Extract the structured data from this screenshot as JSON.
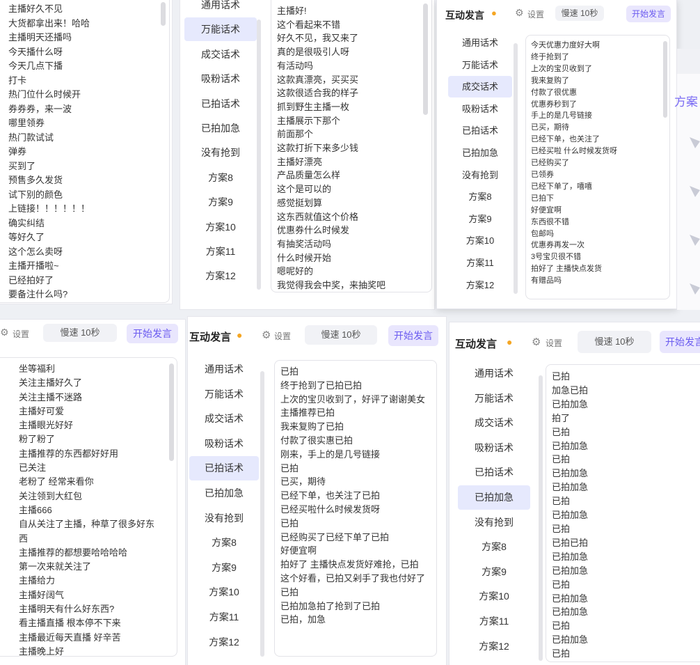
{
  "header": {
    "title": "互动发言",
    "settings_label": "设置",
    "speed_label": "慢速 10秒",
    "start_label": "开始发言"
  },
  "categories": [
    "通用话术",
    "万能话术",
    "成交话术",
    "吸粉话术",
    "已拍话术",
    "已拍加急",
    "没有抢到",
    "方案8",
    "方案9",
    "方案10",
    "方案11",
    "方案12"
  ],
  "panel_a_lines": [
    "主播好久不见",
    "大货都拿出来！哈哈",
    "主播明天还播吗",
    "今天播什么呀",
    "今天几点下播",
    "打卡",
    "热门位什么时候开",
    "券券券，来一波",
    "哪里领券",
    "热门款试试",
    "弹券",
    "买到了",
    "预售多久发货",
    "试下别的颜色",
    "上链接！！！！！！",
    "确实纠结",
    "等好久了",
    "这个怎么卖呀",
    "主播开播啦~",
    "已经拍好了",
    "要备注什么吗?"
  ],
  "panel_b_lines": [
    "主播好!",
    "这个看起来不错",
    "好久不见，我又来了",
    "真的是很吸引人呀",
    "有活动吗",
    "这款真漂亮，买买买",
    "这款很适合我的样子",
    "抓到野生主播一枚",
    "主播展示下那个",
    "前面那个",
    "这款打折下来多少钱",
    "主播好漂亮",
    "产品质量怎么样",
    "这个是可以的",
    "感觉挺划算",
    "这东西就值这个价格",
    "优惠券什么时候发",
    "有抽奖活动吗",
    "什么时候开始",
    "嗯呢好的",
    "我觉得我会中奖，来抽奖吧"
  ],
  "panel_c_lines": [
    "今天优惠力度好大啊",
    "终于抢到了",
    "上次的宝贝收到了",
    "我来复购了",
    "付款了很优惠",
    "优惠券秒到了",
    "手上的是几号链接",
    "已买，期待",
    "已经下单，也关注了",
    "已经买啦 什么时候发货呀",
    "已经购买了",
    "已领券",
    "已经下单了，嘻嘻",
    "已拍下",
    "好便宜啊",
    "东西很不错",
    "包邮吗",
    "优惠券再发一次",
    "3号宝贝很不错",
    "拍好了 主播快点发货",
    "有赠品吗"
  ],
  "panel_d_lines": [
    "坐等福利",
    "关注主播好久了",
    "关注主播不迷路",
    "主播好可爱",
    "主播眼光好好",
    "粉了粉了",
    "主播推荐的东西都好好用",
    "已关注",
    "老粉了 经常来看你",
    "关注领到大红包",
    "主播666",
    "自从关注了主播，种草了很多好东",
    "西",
    "主播推荐的都想要哈哈哈哈",
    "第一次来就关注了",
    "主播给力",
    "主播好阔气",
    "主播明天有什么好东西?",
    "看主播直播 根本停不下来",
    "主播最近每天直播 好辛苦",
    "主播晚上好"
  ],
  "panel_e_lines": [
    "已拍",
    "终于抢到了已拍已拍",
    "上次的宝贝收到了，好评了谢谢美女",
    "主播推荐已拍",
    "我来复购了已拍",
    "付款了很实惠已拍",
    "刚来，手上的是几号链接",
    "已拍",
    "已买，期待",
    "已经下单，也关注了已拍",
    "已经买啦什么时候发货呀",
    "已拍",
    "已经购买了已经下单了已拍",
    "好便宜啊",
    "拍好了 主播快点发货好难抢，已拍",
    "这个好看，已拍又剁手了我也付好了",
    "已拍",
    "已拍加急拍了抢到了已拍",
    "已拍，加急"
  ],
  "panel_f_lines": [
    "已拍",
    "加急已拍",
    "已拍加急",
    "拍了",
    "已拍",
    "已拍加急",
    "已拍",
    "已拍加急",
    "已拍加急",
    "已拍",
    "已拍加急",
    "已拍",
    "已拍已拍",
    "已拍加急",
    "已拍加急",
    "已拍",
    "已拍加急",
    "已拍加急",
    "已拍",
    "已拍加急",
    "已拍"
  ],
  "fragment": {
    "side_text": "方案"
  },
  "colors": {
    "accent": "#6b5bf0",
    "accent_bg": "#e9e6fd",
    "active_item": "#e6e9fd",
    "bulb": "#f5a623"
  }
}
